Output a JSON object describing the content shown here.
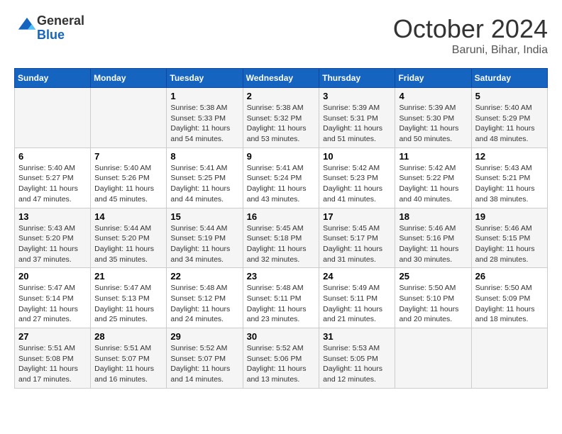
{
  "header": {
    "logo_line1": "General",
    "logo_line2": "Blue",
    "month": "October 2024",
    "location": "Baruni, Bihar, India"
  },
  "days_of_week": [
    "Sunday",
    "Monday",
    "Tuesday",
    "Wednesday",
    "Thursday",
    "Friday",
    "Saturday"
  ],
  "weeks": [
    [
      {
        "day": "",
        "sunrise": "",
        "sunset": "",
        "daylight": ""
      },
      {
        "day": "",
        "sunrise": "",
        "sunset": "",
        "daylight": ""
      },
      {
        "day": "1",
        "sunrise": "Sunrise: 5:38 AM",
        "sunset": "Sunset: 5:33 PM",
        "daylight": "Daylight: 11 hours and 54 minutes."
      },
      {
        "day": "2",
        "sunrise": "Sunrise: 5:38 AM",
        "sunset": "Sunset: 5:32 PM",
        "daylight": "Daylight: 11 hours and 53 minutes."
      },
      {
        "day": "3",
        "sunrise": "Sunrise: 5:39 AM",
        "sunset": "Sunset: 5:31 PM",
        "daylight": "Daylight: 11 hours and 51 minutes."
      },
      {
        "day": "4",
        "sunrise": "Sunrise: 5:39 AM",
        "sunset": "Sunset: 5:30 PM",
        "daylight": "Daylight: 11 hours and 50 minutes."
      },
      {
        "day": "5",
        "sunrise": "Sunrise: 5:40 AM",
        "sunset": "Sunset: 5:29 PM",
        "daylight": "Daylight: 11 hours and 48 minutes."
      }
    ],
    [
      {
        "day": "6",
        "sunrise": "Sunrise: 5:40 AM",
        "sunset": "Sunset: 5:27 PM",
        "daylight": "Daylight: 11 hours and 47 minutes."
      },
      {
        "day": "7",
        "sunrise": "Sunrise: 5:40 AM",
        "sunset": "Sunset: 5:26 PM",
        "daylight": "Daylight: 11 hours and 45 minutes."
      },
      {
        "day": "8",
        "sunrise": "Sunrise: 5:41 AM",
        "sunset": "Sunset: 5:25 PM",
        "daylight": "Daylight: 11 hours and 44 minutes."
      },
      {
        "day": "9",
        "sunrise": "Sunrise: 5:41 AM",
        "sunset": "Sunset: 5:24 PM",
        "daylight": "Daylight: 11 hours and 43 minutes."
      },
      {
        "day": "10",
        "sunrise": "Sunrise: 5:42 AM",
        "sunset": "Sunset: 5:23 PM",
        "daylight": "Daylight: 11 hours and 41 minutes."
      },
      {
        "day": "11",
        "sunrise": "Sunrise: 5:42 AM",
        "sunset": "Sunset: 5:22 PM",
        "daylight": "Daylight: 11 hours and 40 minutes."
      },
      {
        "day": "12",
        "sunrise": "Sunrise: 5:43 AM",
        "sunset": "Sunset: 5:21 PM",
        "daylight": "Daylight: 11 hours and 38 minutes."
      }
    ],
    [
      {
        "day": "13",
        "sunrise": "Sunrise: 5:43 AM",
        "sunset": "Sunset: 5:20 PM",
        "daylight": "Daylight: 11 hours and 37 minutes."
      },
      {
        "day": "14",
        "sunrise": "Sunrise: 5:44 AM",
        "sunset": "Sunset: 5:20 PM",
        "daylight": "Daylight: 11 hours and 35 minutes."
      },
      {
        "day": "15",
        "sunrise": "Sunrise: 5:44 AM",
        "sunset": "Sunset: 5:19 PM",
        "daylight": "Daylight: 11 hours and 34 minutes."
      },
      {
        "day": "16",
        "sunrise": "Sunrise: 5:45 AM",
        "sunset": "Sunset: 5:18 PM",
        "daylight": "Daylight: 11 hours and 32 minutes."
      },
      {
        "day": "17",
        "sunrise": "Sunrise: 5:45 AM",
        "sunset": "Sunset: 5:17 PM",
        "daylight": "Daylight: 11 hours and 31 minutes."
      },
      {
        "day": "18",
        "sunrise": "Sunrise: 5:46 AM",
        "sunset": "Sunset: 5:16 PM",
        "daylight": "Daylight: 11 hours and 30 minutes."
      },
      {
        "day": "19",
        "sunrise": "Sunrise: 5:46 AM",
        "sunset": "Sunset: 5:15 PM",
        "daylight": "Daylight: 11 hours and 28 minutes."
      }
    ],
    [
      {
        "day": "20",
        "sunrise": "Sunrise: 5:47 AM",
        "sunset": "Sunset: 5:14 PM",
        "daylight": "Daylight: 11 hours and 27 minutes."
      },
      {
        "day": "21",
        "sunrise": "Sunrise: 5:47 AM",
        "sunset": "Sunset: 5:13 PM",
        "daylight": "Daylight: 11 hours and 25 minutes."
      },
      {
        "day": "22",
        "sunrise": "Sunrise: 5:48 AM",
        "sunset": "Sunset: 5:12 PM",
        "daylight": "Daylight: 11 hours and 24 minutes."
      },
      {
        "day": "23",
        "sunrise": "Sunrise: 5:48 AM",
        "sunset": "Sunset: 5:11 PM",
        "daylight": "Daylight: 11 hours and 23 minutes."
      },
      {
        "day": "24",
        "sunrise": "Sunrise: 5:49 AM",
        "sunset": "Sunset: 5:11 PM",
        "daylight": "Daylight: 11 hours and 21 minutes."
      },
      {
        "day": "25",
        "sunrise": "Sunrise: 5:50 AM",
        "sunset": "Sunset: 5:10 PM",
        "daylight": "Daylight: 11 hours and 20 minutes."
      },
      {
        "day": "26",
        "sunrise": "Sunrise: 5:50 AM",
        "sunset": "Sunset: 5:09 PM",
        "daylight": "Daylight: 11 hours and 18 minutes."
      }
    ],
    [
      {
        "day": "27",
        "sunrise": "Sunrise: 5:51 AM",
        "sunset": "Sunset: 5:08 PM",
        "daylight": "Daylight: 11 hours and 17 minutes."
      },
      {
        "day": "28",
        "sunrise": "Sunrise: 5:51 AM",
        "sunset": "Sunset: 5:07 PM",
        "daylight": "Daylight: 11 hours and 16 minutes."
      },
      {
        "day": "29",
        "sunrise": "Sunrise: 5:52 AM",
        "sunset": "Sunset: 5:07 PM",
        "daylight": "Daylight: 11 hours and 14 minutes."
      },
      {
        "day": "30",
        "sunrise": "Sunrise: 5:52 AM",
        "sunset": "Sunset: 5:06 PM",
        "daylight": "Daylight: 11 hours and 13 minutes."
      },
      {
        "day": "31",
        "sunrise": "Sunrise: 5:53 AM",
        "sunset": "Sunset: 5:05 PM",
        "daylight": "Daylight: 11 hours and 12 minutes."
      },
      {
        "day": "",
        "sunrise": "",
        "sunset": "",
        "daylight": ""
      },
      {
        "day": "",
        "sunrise": "",
        "sunset": "",
        "daylight": ""
      }
    ]
  ]
}
